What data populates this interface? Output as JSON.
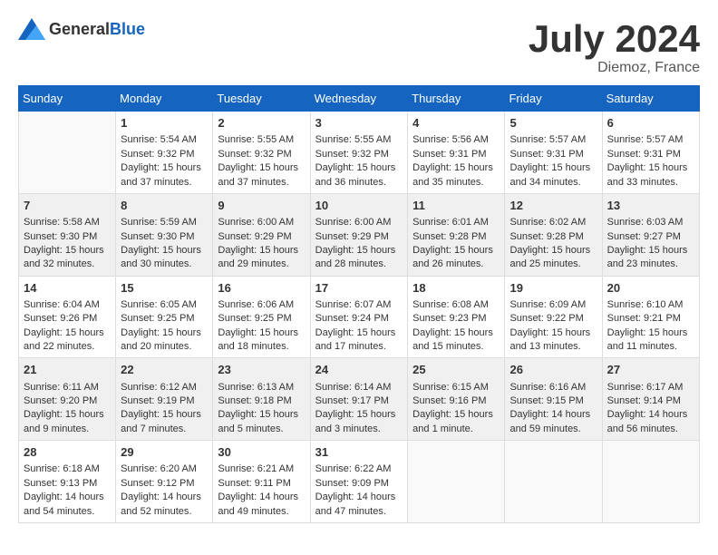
{
  "logo": {
    "general": "General",
    "blue": "Blue"
  },
  "title": {
    "month_year": "July 2024",
    "location": "Diemoz, France"
  },
  "days_header": [
    "Sunday",
    "Monday",
    "Tuesday",
    "Wednesday",
    "Thursday",
    "Friday",
    "Saturday"
  ],
  "weeks": [
    [
      {
        "day": "",
        "info": ""
      },
      {
        "day": "1",
        "info": "Sunrise: 5:54 AM\nSunset: 9:32 PM\nDaylight: 15 hours\nand 37 minutes."
      },
      {
        "day": "2",
        "info": "Sunrise: 5:55 AM\nSunset: 9:32 PM\nDaylight: 15 hours\nand 37 minutes."
      },
      {
        "day": "3",
        "info": "Sunrise: 5:55 AM\nSunset: 9:32 PM\nDaylight: 15 hours\nand 36 minutes."
      },
      {
        "day": "4",
        "info": "Sunrise: 5:56 AM\nSunset: 9:31 PM\nDaylight: 15 hours\nand 35 minutes."
      },
      {
        "day": "5",
        "info": "Sunrise: 5:57 AM\nSunset: 9:31 PM\nDaylight: 15 hours\nand 34 minutes."
      },
      {
        "day": "6",
        "info": "Sunrise: 5:57 AM\nSunset: 9:31 PM\nDaylight: 15 hours\nand 33 minutes."
      }
    ],
    [
      {
        "day": "7",
        "info": "Sunrise: 5:58 AM\nSunset: 9:30 PM\nDaylight: 15 hours\nand 32 minutes."
      },
      {
        "day": "8",
        "info": "Sunrise: 5:59 AM\nSunset: 9:30 PM\nDaylight: 15 hours\nand 30 minutes."
      },
      {
        "day": "9",
        "info": "Sunrise: 6:00 AM\nSunset: 9:29 PM\nDaylight: 15 hours\nand 29 minutes."
      },
      {
        "day": "10",
        "info": "Sunrise: 6:00 AM\nSunset: 9:29 PM\nDaylight: 15 hours\nand 28 minutes."
      },
      {
        "day": "11",
        "info": "Sunrise: 6:01 AM\nSunset: 9:28 PM\nDaylight: 15 hours\nand 26 minutes."
      },
      {
        "day": "12",
        "info": "Sunrise: 6:02 AM\nSunset: 9:28 PM\nDaylight: 15 hours\nand 25 minutes."
      },
      {
        "day": "13",
        "info": "Sunrise: 6:03 AM\nSunset: 9:27 PM\nDaylight: 15 hours\nand 23 minutes."
      }
    ],
    [
      {
        "day": "14",
        "info": "Sunrise: 6:04 AM\nSunset: 9:26 PM\nDaylight: 15 hours\nand 22 minutes."
      },
      {
        "day": "15",
        "info": "Sunrise: 6:05 AM\nSunset: 9:25 PM\nDaylight: 15 hours\nand 20 minutes."
      },
      {
        "day": "16",
        "info": "Sunrise: 6:06 AM\nSunset: 9:25 PM\nDaylight: 15 hours\nand 18 minutes."
      },
      {
        "day": "17",
        "info": "Sunrise: 6:07 AM\nSunset: 9:24 PM\nDaylight: 15 hours\nand 17 minutes."
      },
      {
        "day": "18",
        "info": "Sunrise: 6:08 AM\nSunset: 9:23 PM\nDaylight: 15 hours\nand 15 minutes."
      },
      {
        "day": "19",
        "info": "Sunrise: 6:09 AM\nSunset: 9:22 PM\nDaylight: 15 hours\nand 13 minutes."
      },
      {
        "day": "20",
        "info": "Sunrise: 6:10 AM\nSunset: 9:21 PM\nDaylight: 15 hours\nand 11 minutes."
      }
    ],
    [
      {
        "day": "21",
        "info": "Sunrise: 6:11 AM\nSunset: 9:20 PM\nDaylight: 15 hours\nand 9 minutes."
      },
      {
        "day": "22",
        "info": "Sunrise: 6:12 AM\nSunset: 9:19 PM\nDaylight: 15 hours\nand 7 minutes."
      },
      {
        "day": "23",
        "info": "Sunrise: 6:13 AM\nSunset: 9:18 PM\nDaylight: 15 hours\nand 5 minutes."
      },
      {
        "day": "24",
        "info": "Sunrise: 6:14 AM\nSunset: 9:17 PM\nDaylight: 15 hours\nand 3 minutes."
      },
      {
        "day": "25",
        "info": "Sunrise: 6:15 AM\nSunset: 9:16 PM\nDaylight: 15 hours\nand 1 minute."
      },
      {
        "day": "26",
        "info": "Sunrise: 6:16 AM\nSunset: 9:15 PM\nDaylight: 14 hours\nand 59 minutes."
      },
      {
        "day": "27",
        "info": "Sunrise: 6:17 AM\nSunset: 9:14 PM\nDaylight: 14 hours\nand 56 minutes."
      }
    ],
    [
      {
        "day": "28",
        "info": "Sunrise: 6:18 AM\nSunset: 9:13 PM\nDaylight: 14 hours\nand 54 minutes."
      },
      {
        "day": "29",
        "info": "Sunrise: 6:20 AM\nSunset: 9:12 PM\nDaylight: 14 hours\nand 52 minutes."
      },
      {
        "day": "30",
        "info": "Sunrise: 6:21 AM\nSunset: 9:11 PM\nDaylight: 14 hours\nand 49 minutes."
      },
      {
        "day": "31",
        "info": "Sunrise: 6:22 AM\nSunset: 9:09 PM\nDaylight: 14 hours\nand 47 minutes."
      },
      {
        "day": "",
        "info": ""
      },
      {
        "day": "",
        "info": ""
      },
      {
        "day": "",
        "info": ""
      }
    ]
  ]
}
